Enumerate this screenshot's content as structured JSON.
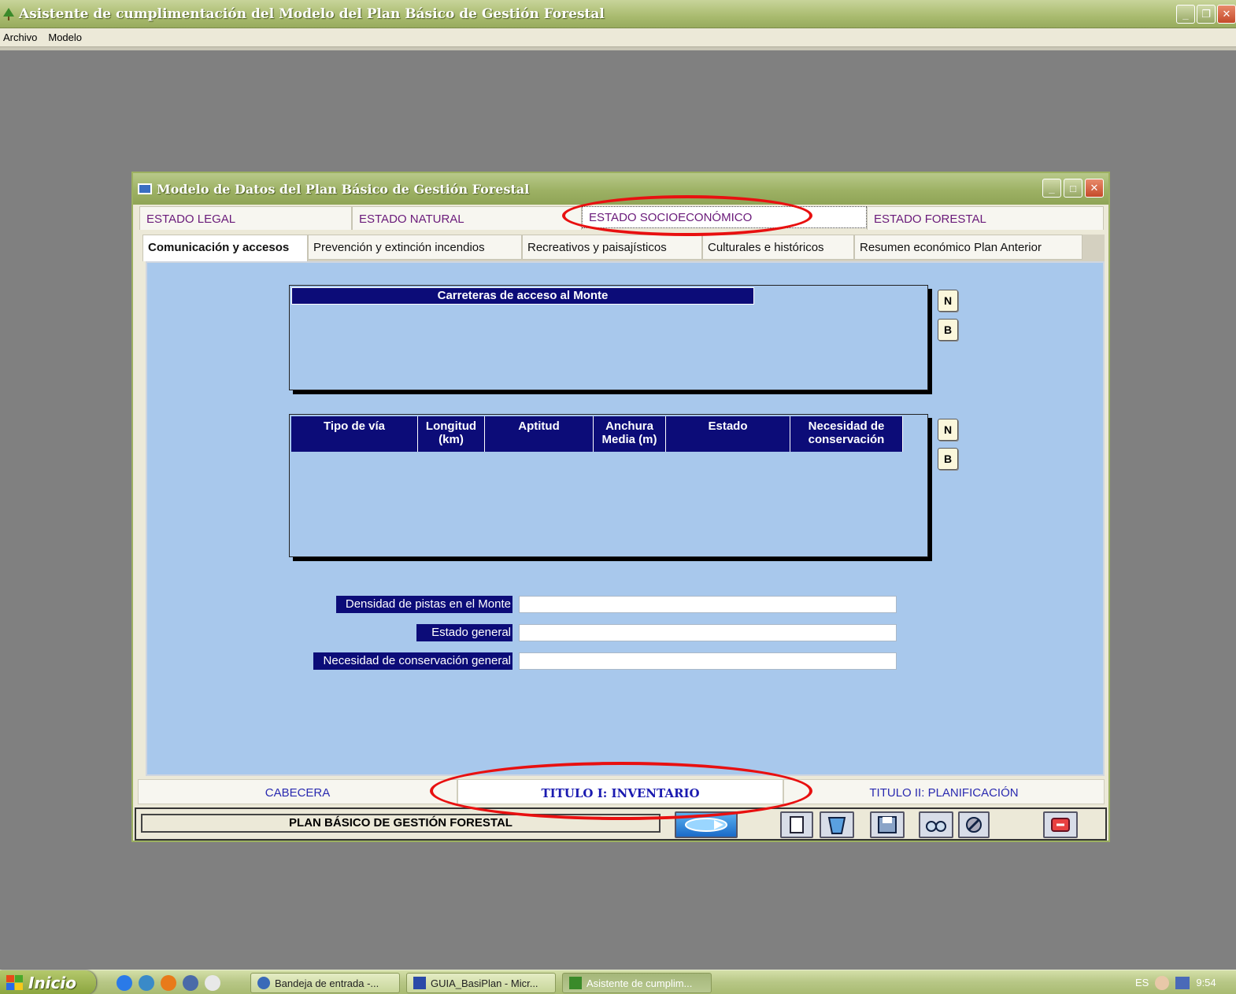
{
  "app": {
    "title": "Asistente de cumplimentación del Modelo del Plan Básico de Gestión Forestal",
    "menu": [
      "Archivo",
      "Modelo"
    ]
  },
  "form": {
    "title": "Modelo de Datos del Plan Básico de Gestión Forestal",
    "top_tabs": [
      {
        "label": "ESTADO LEGAL",
        "active": false
      },
      {
        "label": "ESTADO NATURAL",
        "active": false
      },
      {
        "label": "ESTADO SOCIOECONÓMICO",
        "active": true
      },
      {
        "label": "ESTADO FORESTAL",
        "active": false
      }
    ],
    "sub_tabs": [
      {
        "label": "Comunicación y accesos",
        "active": true
      },
      {
        "label": "Prevención y extinción incendios",
        "active": false
      },
      {
        "label": "Recreativos y paisajísticos",
        "active": false
      },
      {
        "label": "Culturales e históricos",
        "active": false
      },
      {
        "label": "Resumen económico Plan Anterior",
        "active": false
      }
    ],
    "carreteras": {
      "header": "Carreteras de acceso al Monte",
      "btn_new": "N",
      "btn_delete": "B"
    },
    "vias_table": {
      "columns": [
        "Tipo de vía",
        "Longitud (km)",
        "Aptitud",
        "Anchura Media (m)",
        "Estado",
        "Necesidad de conservación"
      ],
      "btn_new": "N",
      "btn_delete": "B"
    },
    "fields": {
      "densidad_label": "Densidad de pistas en el Monte",
      "densidad_value": "",
      "estado_label": "Estado general",
      "estado_value": "",
      "necesidad_label": "Necesidad de conservación general",
      "necesidad_value": ""
    },
    "bottom_tabs": [
      {
        "label": "CABECERA",
        "active": false
      },
      {
        "label": "TITULO I: INVENTARIO",
        "active": true
      },
      {
        "label": "TITULO II: PLANIFICACIÓN",
        "active": false
      }
    ],
    "toolbar": {
      "plan_label": "PLAN BÁSICO DE GESTIÓN FORESTAL",
      "buttons": [
        "navigate-icon",
        "new-document-icon",
        "trash-icon",
        "save-icon",
        "search-icon",
        "tools-icon",
        "exit-icon"
      ]
    }
  },
  "taskbar": {
    "start_label": "Inicio",
    "items": [
      {
        "label": "Bandeja de entrada -...",
        "active": false
      },
      {
        "label": "GUIA_BasiPlan - Micr...",
        "active": false
      },
      {
        "label": "Asistente de cumplim...",
        "active": true
      }
    ],
    "lang": "ES",
    "clock": "9:54"
  },
  "colors": {
    "panel_blue": "#a8c8ec",
    "header_navy": "#0c0c78",
    "annotation_red": "#e81010",
    "tab_text_purple": "#6a1a7a"
  }
}
